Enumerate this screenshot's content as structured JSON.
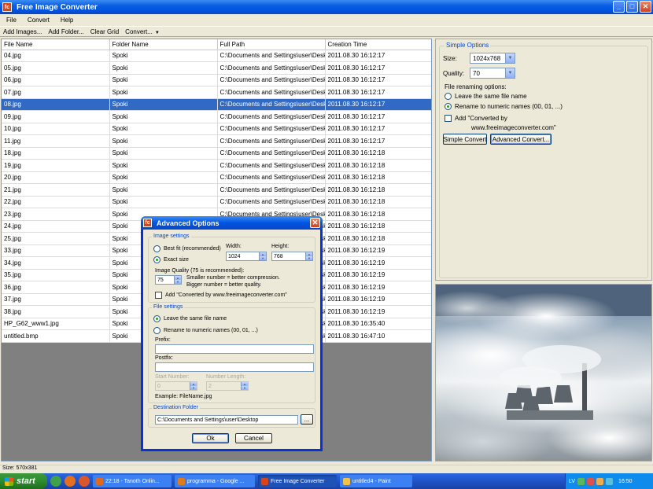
{
  "window": {
    "title": "Free Image Converter",
    "app_icon": "fc"
  },
  "menu": [
    "File",
    "Convert",
    "Help"
  ],
  "toolbar": {
    "add_images": "Add Images...",
    "add_folder": "Add Folder...",
    "clear_grid": "Clear Grid",
    "convert": "Convert..."
  },
  "grid": {
    "columns": [
      "File Name",
      "Folder Name",
      "Full Path",
      "Creation Time"
    ],
    "rows": [
      [
        "04.jpg",
        "Spoki",
        "C:\\Documents and Settings\\user\\Deskt...",
        "2011.08.30 16:12:17"
      ],
      [
        "05.jpg",
        "Spoki",
        "C:\\Documents and Settings\\user\\Deskt...",
        "2011.08.30 16:12:17"
      ],
      [
        "06.jpg",
        "Spoki",
        "C:\\Documents and Settings\\user\\Deskt...",
        "2011.08.30 16:12:17"
      ],
      [
        "07.jpg",
        "Spoki",
        "C:\\Documents and Settings\\user\\Deskt...",
        "2011.08.30 16:12:17"
      ],
      [
        "08.jpg",
        "Spoki",
        "C:\\Documents and Settings\\user\\Deskt...",
        "2011.08.30 16:12:17"
      ],
      [
        "09.jpg",
        "Spoki",
        "C:\\Documents and Settings\\user\\Deskt...",
        "2011.08.30 16:12:17"
      ],
      [
        "10.jpg",
        "Spoki",
        "C:\\Documents and Settings\\user\\Deskt...",
        "2011.08.30 16:12:17"
      ],
      [
        "11.jpg",
        "Spoki",
        "C:\\Documents and Settings\\user\\Deskt...",
        "2011.08.30 16:12:17"
      ],
      [
        "18.jpg",
        "Spoki",
        "C:\\Documents and Settings\\user\\Deskt...",
        "2011.08.30 16:12:18"
      ],
      [
        "19.jpg",
        "Spoki",
        "C:\\Documents and Settings\\user\\Deskt...",
        "2011.08.30 16:12:18"
      ],
      [
        "20.jpg",
        "Spoki",
        "C:\\Documents and Settings\\user\\Deskt...",
        "2011.08.30 16:12:18"
      ],
      [
        "21.jpg",
        "Spoki",
        "C:\\Documents and Settings\\user\\Deskt...",
        "2011.08.30 16:12:18"
      ],
      [
        "22.jpg",
        "Spoki",
        "C:\\Documents and Settings\\user\\Deskt...",
        "2011.08.30 16:12:18"
      ],
      [
        "23.jpg",
        "Spoki",
        "C:\\Documents and Settings\\user\\Deskt...",
        "2011.08.30 16:12:18"
      ],
      [
        "24.jpg",
        "Spoki",
        "C:\\Documents and Settings\\user\\Deskt...",
        "2011.08.30 16:12:18"
      ],
      [
        "25.jpg",
        "Spoki",
        "C:\\Documents and Settings\\user\\Deskt...",
        "2011.08.30 16:12:18"
      ],
      [
        "33.jpg",
        "Spoki",
        "C:\\Documents and Settings\\user\\Deskt...",
        "2011.08.30 16:12:19"
      ],
      [
        "34.jpg",
        "Spoki",
        "C:\\Documents and Settings\\user\\Deskt...",
        "2011.08.30 16:12:19"
      ],
      [
        "35.jpg",
        "Spoki",
        "C:\\Documents and Settings\\user\\Deskt...",
        "2011.08.30 16:12:19"
      ],
      [
        "36.jpg",
        "Spoki",
        "C:\\Documents and Settings\\user\\Deskt...",
        "2011.08.30 16:12:19"
      ],
      [
        "37.jpg",
        "Spoki",
        "C:\\Documents and Settings\\user\\Deskt...",
        "2011.08.30 16:12:19"
      ],
      [
        "38.jpg",
        "Spoki",
        "C:\\Documents and Settings\\user\\Deskt...",
        "2011.08.30 16:12:19"
      ],
      [
        "HP_G62_www1.jpg",
        "Spoki",
        "C:\\Documents and Settings\\user\\Deskt...",
        "2011.08.30 16:35:40"
      ],
      [
        "untitled.bmp",
        "Spoki",
        "C:\\Documents and Settings\\user\\Deskt...",
        "2011.08.30 16:47:10"
      ]
    ],
    "selected_file": "08.jpg"
  },
  "simple_options": {
    "title": "Simple Options",
    "size_label": "Size:",
    "size_value": "1024x768",
    "quality_label": "Quality:",
    "quality_value": "70",
    "renaming_label": "File renaming options:",
    "leave_same": "Leave the same file name",
    "rename_numeric": "Rename to numeric names (00, 01, ...)",
    "rename_numeric_checked": true,
    "add_converted_line1": "Add \"Converted by",
    "add_converted_line2": "www.freeimageconverter.com\"",
    "simple_convert": "Simple Convert",
    "advanced_convert": "Advanced Convert..."
  },
  "status": {
    "text": "Size: 570x381"
  },
  "dialog": {
    "title": "Advanced Options",
    "image_settings": "Image settings",
    "best_fit": "Best fit (recommended)",
    "exact_size": "Exact size",
    "exact_size_checked": true,
    "width_label": "Width:",
    "width_value": "1024",
    "height_label": "Height:",
    "height_value": "768",
    "quality_label": "Image Quality (75 is recommended):",
    "quality_value": "75",
    "quality_hint1": "Smaller number = better compression.",
    "quality_hint2": "Bigger number = better quality.",
    "add_converted": "Add \"Converted by www.freeimageconverter.com\"",
    "file_settings": "File settings",
    "leave_same": "Leave the same file name",
    "leave_same_checked": true,
    "rename_numeric": "Rename to numeric names (00, 01, ...)",
    "prefix_label": "Prefix:",
    "prefix_value": "",
    "postfix_label": "Postfix:",
    "postfix_value": "",
    "start_number_label": "Start Number:",
    "start_number_value": "0",
    "number_length_label": "Number Length:",
    "number_length_value": "2",
    "example": "Example: FileName.jpg",
    "destination_label": "Destination Folder",
    "destination_value": "C:\\Documents and Settings\\user\\Desktop",
    "browse": "...",
    "ok": "Ok",
    "cancel": "Cancel"
  },
  "taskbar": {
    "start": "start",
    "tasks": [
      {
        "label": "22:18 - Tanoth Onlin...",
        "icon_color": "#e06a1c",
        "active": false
      },
      {
        "label": "programma - Google ...",
        "icon_color": "#e07b1c",
        "active": false
      },
      {
        "label": "Free Image Converter",
        "icon_color": "#d8451b",
        "active": true
      },
      {
        "label": "untitled4 - Paint",
        "icon_color": "#f2c24a",
        "active": false
      }
    ],
    "lang": "LV",
    "clock": "16:50"
  }
}
